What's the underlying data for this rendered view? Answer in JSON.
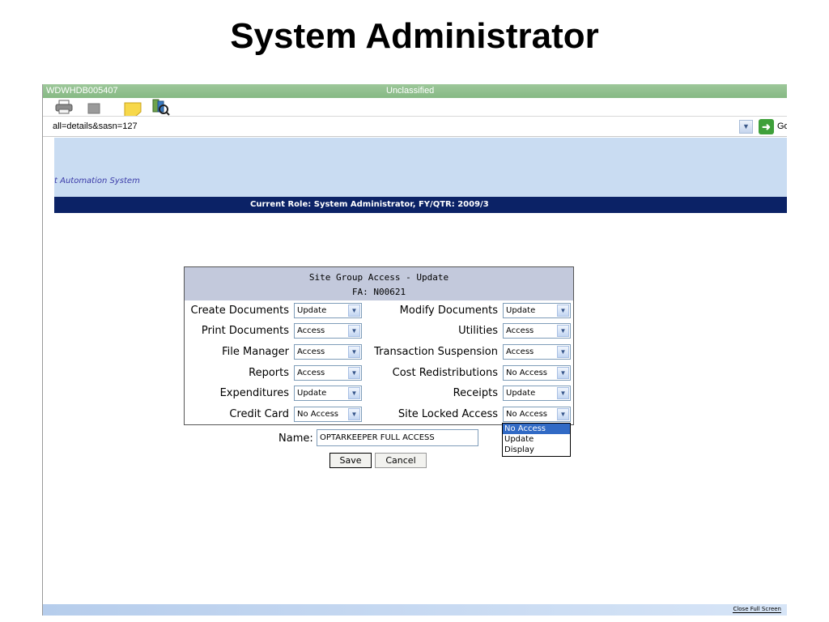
{
  "slide": {
    "title": "System Administrator"
  },
  "browser": {
    "title_host": "WDWHDB005407",
    "classification": "Unclassified",
    "address": "all=details&sasn=127",
    "go_label": "Go",
    "status_link": "Close Full Screen",
    "toolbar_icons": [
      "printer-icon",
      "stop-icon",
      "note-icon",
      "search-icon"
    ]
  },
  "header": {
    "app_name": "t Automation System",
    "role_line": "Current Role:  System Administrator,    FY/QTR:  2009/3",
    "banner_color": "#c9dcf2",
    "role_bar_color": "#0b2266"
  },
  "form": {
    "title": "Site Group Access - Update",
    "fa": "FA: N00621",
    "rows": [
      {
        "left_label": "Create Documents",
        "left_value": "Update",
        "right_label": "Modify Documents",
        "right_value": "Update"
      },
      {
        "left_label": "Print Documents",
        "left_value": "Access",
        "right_label": "Utilities",
        "right_value": "Access"
      },
      {
        "left_label": "File Manager",
        "left_value": "Access",
        "right_label": "Transaction Suspension",
        "right_value": "Access"
      },
      {
        "left_label": "Reports",
        "left_value": "Access",
        "right_label": "Cost Redistributions",
        "right_value": "No Access"
      },
      {
        "left_label": "Expenditures",
        "left_value": "Update",
        "right_label": "Receipts",
        "right_value": "Update"
      },
      {
        "left_label": "Credit Card",
        "left_value": "No Access",
        "right_label": "Site Locked Access",
        "right_value": "No Access"
      }
    ],
    "dropdown_options": [
      "No Access",
      "Update",
      "Display"
    ],
    "dropdown_selected": "No Access",
    "name_label": "Name:",
    "name_value": "OPTARKEEPER FULL ACCESS",
    "save_label": "Save",
    "cancel_label": "Cancel"
  }
}
